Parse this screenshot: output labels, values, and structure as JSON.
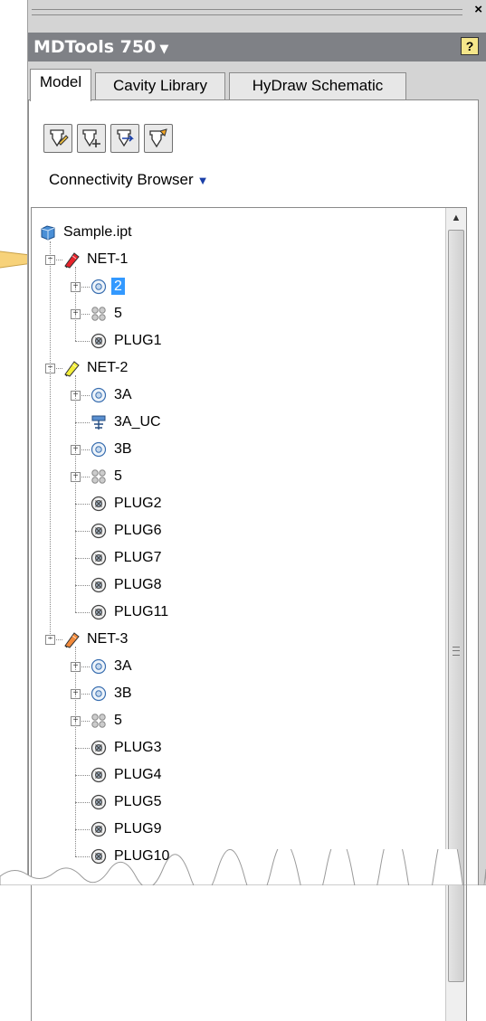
{
  "panel": {
    "title": "MDTools 750",
    "title_caret": "▼",
    "help_label": "?",
    "close_label": "×"
  },
  "tabs": [
    {
      "label": "Model",
      "active": true
    },
    {
      "label": "Cavity Library",
      "active": false
    },
    {
      "label": "HyDraw Schematic",
      "active": false
    }
  ],
  "toolbar": {
    "buttons": [
      {
        "icon": "edit-cavity-icon"
      },
      {
        "icon": "add-cavity-icon"
      },
      {
        "icon": "flow-cavity-icon"
      },
      {
        "icon": "settings-cavity-icon"
      }
    ]
  },
  "browser": {
    "label": "Connectivity Browser",
    "arrow": "▼"
  },
  "scroll_up": "▲",
  "tree": {
    "root": "Sample.ipt",
    "nets": [
      {
        "label": "NET-1",
        "color": "#e8232b",
        "children": [
          {
            "label": "2",
            "icon": "cavity-icon",
            "expandable": true,
            "selected": true
          },
          {
            "label": "5",
            "icon": "cavity-array-icon",
            "expandable": true
          },
          {
            "label": "PLUG1",
            "icon": "plug-icon",
            "expandable": false
          }
        ]
      },
      {
        "label": "NET-2",
        "color": "#f3ee3a",
        "children": [
          {
            "label": "3A",
            "icon": "cavity-icon",
            "expandable": true
          },
          {
            "label": "3A_UC",
            "icon": "port-icon",
            "expandable": false
          },
          {
            "label": "3B",
            "icon": "cavity-icon",
            "expandable": true
          },
          {
            "label": "5",
            "icon": "cavity-array-icon",
            "expandable": true
          },
          {
            "label": "PLUG2",
            "icon": "plug-icon",
            "expandable": false
          },
          {
            "label": "PLUG6",
            "icon": "plug-icon",
            "expandable": false
          },
          {
            "label": "PLUG7",
            "icon": "plug-icon",
            "expandable": false
          },
          {
            "label": "PLUG8",
            "icon": "plug-icon",
            "expandable": false
          },
          {
            "label": "PLUG11",
            "icon": "plug-icon",
            "expandable": false
          }
        ]
      },
      {
        "label": "NET-3",
        "color": "#f28a3b",
        "children": [
          {
            "label": "3A",
            "icon": "cavity-icon",
            "expandable": true
          },
          {
            "label": "3B",
            "icon": "cavity-icon",
            "expandable": true
          },
          {
            "label": "5",
            "icon": "cavity-array-icon",
            "expandable": true
          },
          {
            "label": "PLUG3",
            "icon": "plug-icon",
            "expandable": false
          },
          {
            "label": "PLUG4",
            "icon": "plug-icon",
            "expandable": false
          },
          {
            "label": "PLUG5",
            "icon": "plug-icon",
            "expandable": false
          },
          {
            "label": "PLUG9",
            "icon": "plug-icon",
            "expandable": false
          },
          {
            "label": "PLUG10",
            "icon": "plug-icon",
            "expandable": false
          }
        ]
      }
    ]
  },
  "colors": {
    "titlebar": "#7f8186",
    "selection": "#3399ff",
    "callout": "#f7d27a"
  }
}
